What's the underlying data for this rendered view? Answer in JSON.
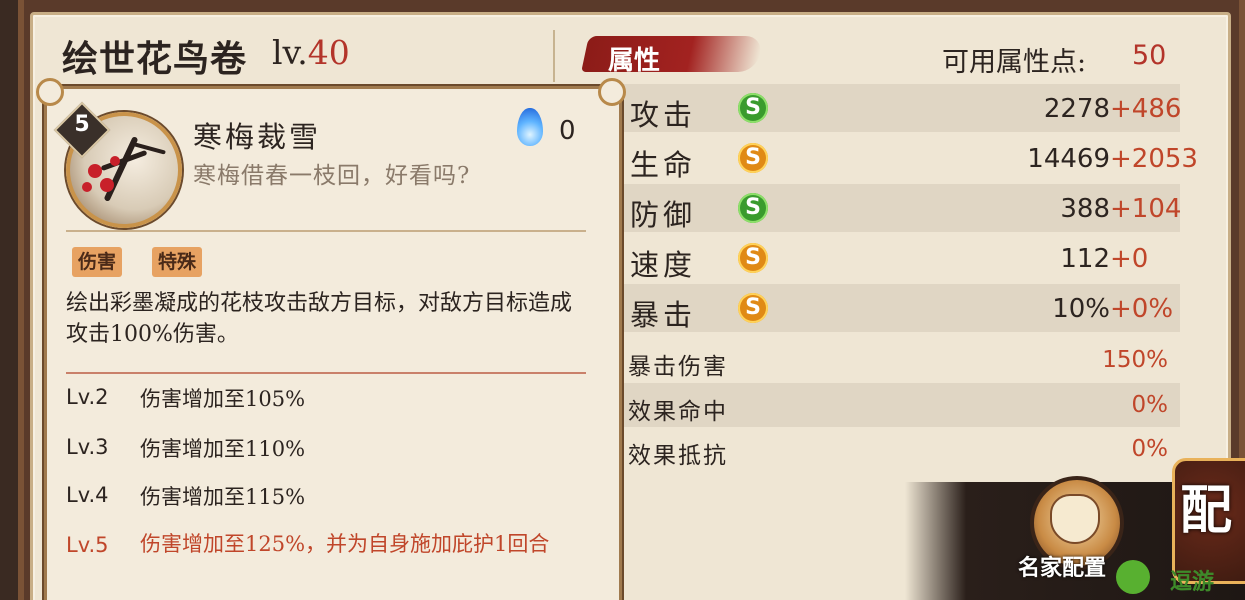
{
  "character": {
    "name": "绘世花鸟卷",
    "level_prefix": "lv.",
    "level": "40"
  },
  "attributes_title": "属性",
  "available_points": {
    "label": "可用属性点:",
    "value": "50"
  },
  "main_attributes": [
    {
      "name": "攻击",
      "rank_icon": "green-rank-icon",
      "base": "2278",
      "bonus": "+486"
    },
    {
      "name": "生命",
      "rank_icon": "orange-rank-icon",
      "base": "14469",
      "bonus": "+2053"
    },
    {
      "name": "防御",
      "rank_icon": "green-rank-icon",
      "base": "388",
      "bonus": "+104"
    },
    {
      "name": "速度",
      "rank_icon": "orange-rank-icon",
      "base": "112",
      "bonus": "+0"
    },
    {
      "name": "暴击",
      "rank_icon": "orange-rank-icon",
      "base": "10%",
      "bonus": "+0%"
    }
  ],
  "secondary_attributes": [
    {
      "name": "暴击伤害",
      "value": "150%"
    },
    {
      "name": "效果命中",
      "value": "0%"
    },
    {
      "name": "效果抵抗",
      "value": "0%"
    }
  ],
  "skill": {
    "level_badge": "5",
    "name": "寒梅裁雪",
    "quote": "寒梅借春一枝回，好看吗?",
    "cost_icon": "blue-flame-icon",
    "cost": "0",
    "tags": [
      "伤害",
      "特殊"
    ],
    "description": "绘出彩墨凝成的花枝攻击敌方目标，对敌方目标造成攻击100%伤害。",
    "upgrades": [
      {
        "level": "Lv.2",
        "text": "伤害增加至105%"
      },
      {
        "level": "Lv.3",
        "text": "伤害增加至110%"
      },
      {
        "level": "Lv.4",
        "text": "伤害增加至115%"
      },
      {
        "level": "Lv.5",
        "text": "伤害增加至125%，并为自身施加庇护1回合"
      }
    ]
  },
  "buttons": {
    "famous_config": "名家配置",
    "config_partial": "配"
  },
  "watermark": {
    "text": "逗游"
  },
  "colors": {
    "accent_red": "#b3342a",
    "bonus_orange": "#c0462a",
    "rank_green": "#3a9b2e",
    "rank_orange": "#e08a16"
  }
}
